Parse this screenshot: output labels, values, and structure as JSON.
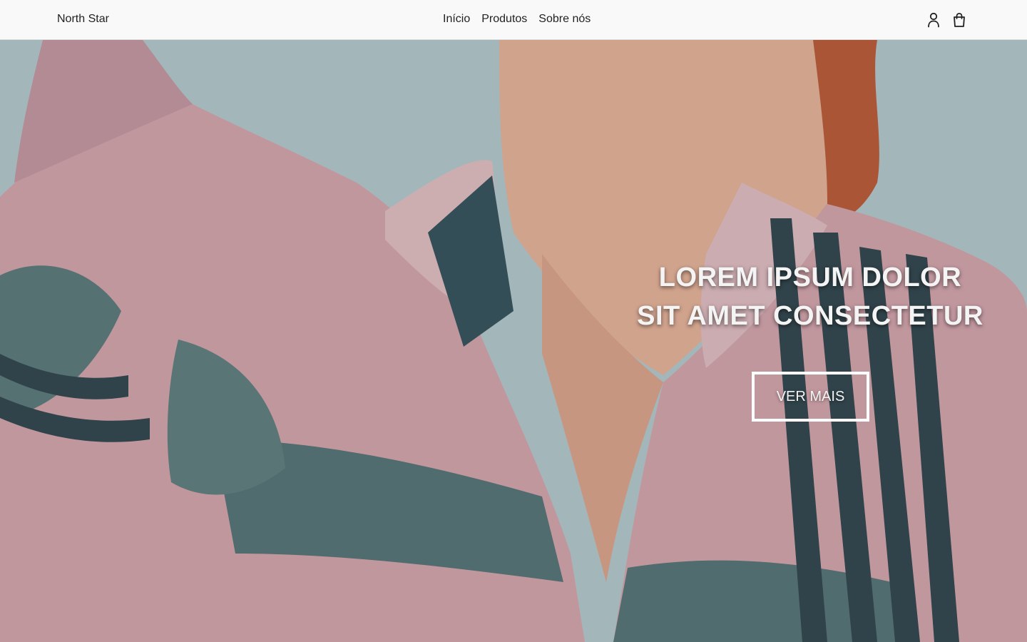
{
  "navbar": {
    "brand": "North Star",
    "links": [
      "Início",
      "Produtos",
      "Sobre nós"
    ],
    "icons": [
      "user-icon",
      "shopping-bag-icon"
    ]
  },
  "hero": {
    "title_line1": "LOREM IPSUM DOLOR",
    "title_line2": "SIT AMET CONSECTETUR",
    "button_label": "VER MAIS",
    "image_description_colors": {
      "sky": "#a9bcbf",
      "shirt_pink": "#c99aa0",
      "shirt_teal": "#4f6b6c",
      "shirt_dark": "#2c3e45",
      "skin": "#d9a68e",
      "hair": "#b85a34"
    }
  }
}
